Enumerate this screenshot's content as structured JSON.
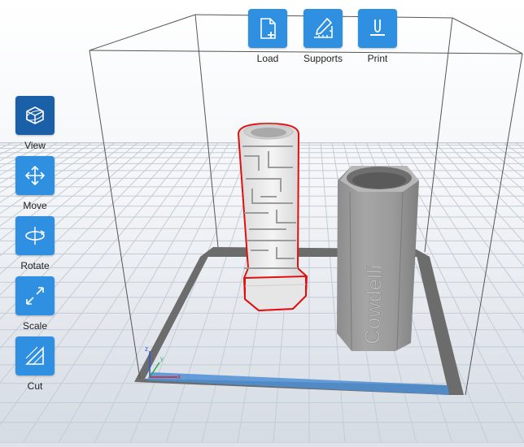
{
  "app": {
    "accent_color": "#2f8fe0",
    "active_color": "#1a5fa8",
    "selection_color": "#e01010"
  },
  "top_toolbar": {
    "items": [
      {
        "id": "load",
        "label": "Load",
        "icon": "file-plus-icon"
      },
      {
        "id": "supports",
        "label": "Supports",
        "icon": "pencil-ruler-icon"
      },
      {
        "id": "print",
        "label": "Print",
        "icon": "download-tray-icon"
      }
    ]
  },
  "side_toolbar": {
    "items": [
      {
        "id": "view",
        "label": "View",
        "icon": "cube-view-icon",
        "active": true
      },
      {
        "id": "move",
        "label": "Move",
        "icon": "move-arrows-icon"
      },
      {
        "id": "rotate",
        "label": "Rotate",
        "icon": "rotate-orbit-icon"
      },
      {
        "id": "scale",
        "label": "Scale",
        "icon": "scale-arrows-icon"
      },
      {
        "id": "cut",
        "label": "Cut",
        "icon": "cut-triangle-icon"
      }
    ]
  },
  "scene": {
    "axes": {
      "x": "x",
      "y": "y",
      "z": "z"
    },
    "models": [
      {
        "name": "maze-cylinder",
        "selected": true
      },
      {
        "name": "hexagonal-cup",
        "selected": false,
        "engraved_text": "Cowdelli"
      }
    ]
  }
}
